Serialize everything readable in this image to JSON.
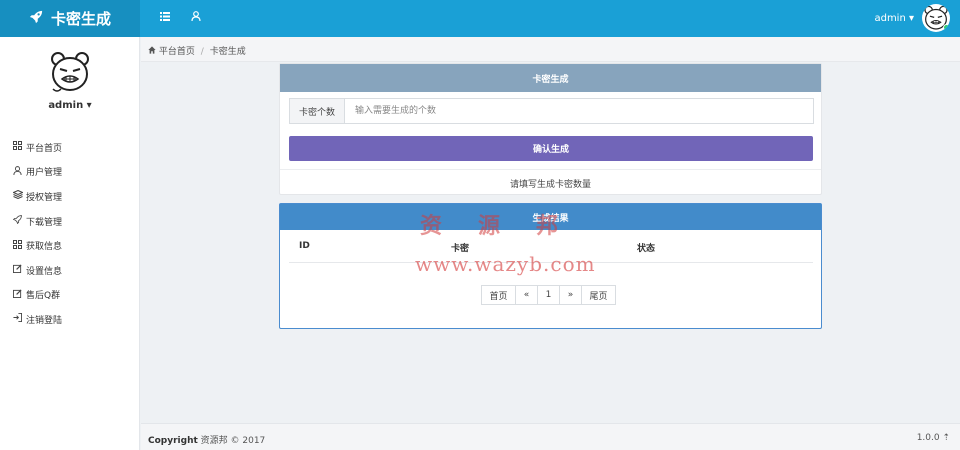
{
  "app": {
    "title": "卡密生成"
  },
  "topbar": {
    "username": "admin ▾"
  },
  "sidebar": {
    "username": "admin ▾",
    "items": [
      {
        "label": "平台首页",
        "icon": "grid-icon"
      },
      {
        "label": "用户管理",
        "icon": "user-icon"
      },
      {
        "label": "授权管理",
        "icon": "layers-icon"
      },
      {
        "label": "下载管理",
        "icon": "rocket-icon"
      },
      {
        "label": "获取信息",
        "icon": "grid-icon"
      },
      {
        "label": "设置信息",
        "icon": "edit-icon"
      },
      {
        "label": "售后Q群",
        "icon": "edit-icon"
      },
      {
        "label": "注销登陆",
        "icon": "logout-icon"
      }
    ]
  },
  "breadcrumb": {
    "home": "平台首页",
    "sep": "/",
    "current": "卡密生成"
  },
  "generate_panel": {
    "title": "卡密生成",
    "count_label": "卡密个数",
    "count_placeholder": "输入需要生成的个数",
    "submit_label": "确认生成",
    "hint": "请填写生成卡密数量"
  },
  "result_panel": {
    "title": "生成结果",
    "columns": [
      "ID",
      "卡密",
      "状态"
    ],
    "pagination": [
      "首页",
      "«",
      "1",
      "»",
      "尾页"
    ]
  },
  "watermark": {
    "cn": "资源邦",
    "url": "www.wazyb.com"
  },
  "footer": {
    "copyright_bold": "Copyright",
    "copyright_rest": " 资源邦 © 2017",
    "version": "1.0.0 ⇡"
  },
  "colors": {
    "topbar": "#1aa0d6",
    "generate_header": "#87a4bd",
    "submit_button": "#7165b8",
    "result_header": "#428bca"
  }
}
